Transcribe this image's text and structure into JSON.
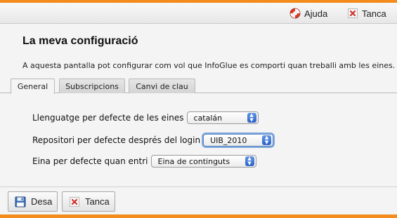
{
  "header": {
    "help_label": "Ajuda",
    "close_label": "Tanca"
  },
  "page": {
    "title": "La meva configuració",
    "description": "A aquesta pantalla pot configurar com vol que InfoGlue es comporti quan treballi amb les eines."
  },
  "tabs": [
    {
      "label": "General",
      "active": true
    },
    {
      "label": "Subscripcions",
      "active": false
    },
    {
      "label": "Canvi de clau",
      "active": false
    }
  ],
  "form": {
    "fields": [
      {
        "label": "Llenguatge per defecte de les eines",
        "value": "catalán"
      },
      {
        "label": "Repositori per defecte després del login",
        "value": "UIB_2010"
      },
      {
        "label": "Eina per defecte quan entri",
        "value": "Eina de continguts"
      }
    ]
  },
  "footer": {
    "save_label": "Desa",
    "close_label": "Tanca"
  },
  "colors": {
    "accent": "#f38b1d",
    "focus": "#7fa9dc",
    "select_arrow": "#2c64c8"
  },
  "icons": {
    "help": "lifebuoy-icon",
    "close": "close-icon",
    "save": "floppy-disk-icon"
  }
}
